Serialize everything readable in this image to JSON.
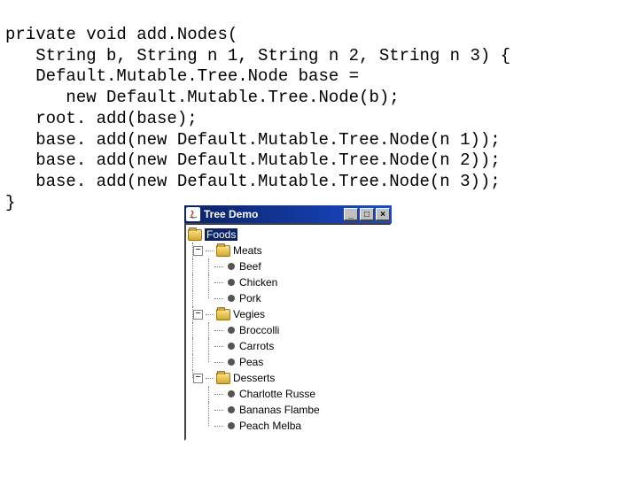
{
  "code": {
    "l1": "private void add.Nodes(",
    "l2": "   String b, String n 1, String n 2, String n 3) {",
    "l3": "   Default.Mutable.Tree.Node base =",
    "l4": "      new Default.Mutable.Tree.Node(b);",
    "l5": "   root. add(base);",
    "l6": "   base. add(new Default.Mutable.Tree.Node(n 1));",
    "l7": "   base. add(new Default.Mutable.Tree.Node(n 2));",
    "l8": "   base. add(new Default.Mutable.Tree.Node(n 3));",
    "l9": "}"
  },
  "window": {
    "title": "Tree Demo",
    "min": "_",
    "max": "□",
    "close": "×"
  },
  "tree": {
    "root": "Foods",
    "cats": [
      {
        "name": "Meats",
        "exp": "−",
        "items": [
          "Beef",
          "Chicken",
          "Pork"
        ]
      },
      {
        "name": "Vegies",
        "exp": "−",
        "items": [
          "Broccolli",
          "Carrots",
          "Peas"
        ]
      },
      {
        "name": "Desserts",
        "exp": "−",
        "items": [
          "Charlotte Russe",
          "Bananas Flambe",
          "Peach Melba"
        ]
      }
    ]
  }
}
